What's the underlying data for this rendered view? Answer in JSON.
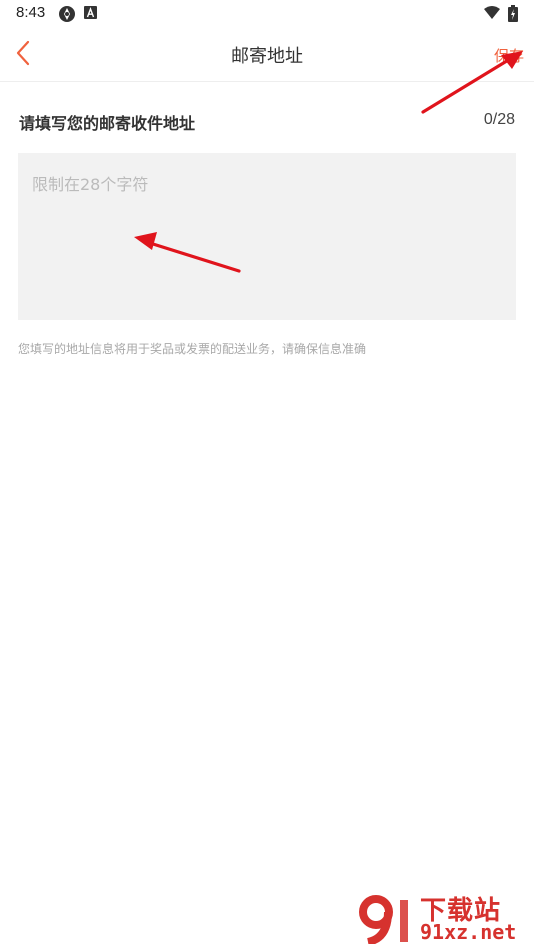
{
  "status_bar": {
    "time": "8:43",
    "icons": [
      "sync-icon",
      "a-badge-icon",
      "wifi-icon",
      "battery-icon"
    ]
  },
  "header": {
    "title": "邮寄地址",
    "back_icon": "chevron-left-icon",
    "save_label": "保存"
  },
  "form": {
    "section_label": "请填写您的邮寄收件地址",
    "counter": "0/28",
    "input_value": "",
    "input_placeholder": "限制在28个字符",
    "max_length": 28,
    "hint": "您填写的地址信息将用于奖品或发票的配送业务，请确保信息准确"
  },
  "watermark": {
    "brand": "下载站",
    "domain": "91xz.net"
  },
  "colors": {
    "accent": "#f0623e",
    "input_background": "#f2f2f2",
    "placeholder": "#bbbbbb",
    "hint_text": "#a8a8a8",
    "annotation_arrow": "#e0141c",
    "watermark": "#d6322e"
  }
}
